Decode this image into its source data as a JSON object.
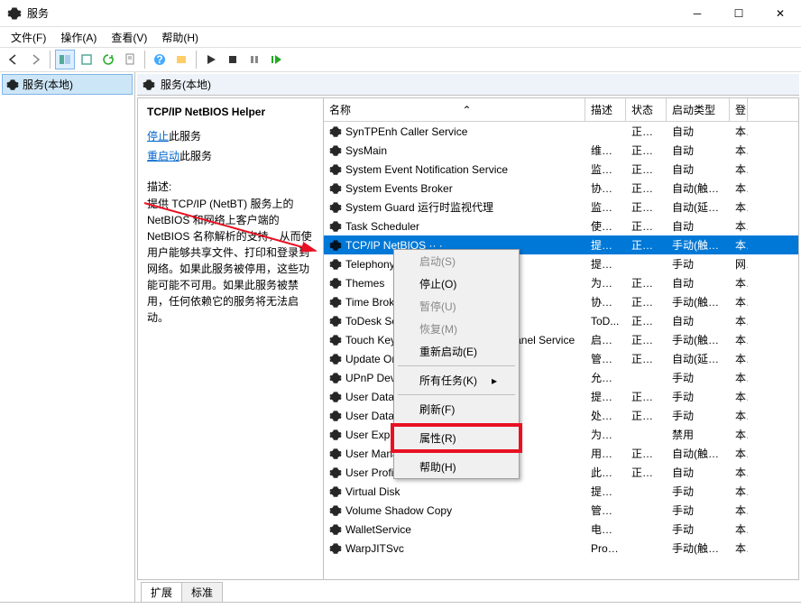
{
  "window": {
    "title": "服务"
  },
  "menus": {
    "file": "文件(F)",
    "action": "操作(A)",
    "view": "查看(V)",
    "help": "帮助(H)"
  },
  "left": {
    "node": "服务(本地)"
  },
  "rheader": {
    "title": "服务(本地)"
  },
  "detail": {
    "name": "TCP/IP NetBIOS Helper",
    "stop": "停止",
    "restart": "重启动",
    "suffix": "此服务",
    "desc_label": "描述:",
    "desc": "提供 TCP/IP (NetBT) 服务上的 NetBIOS 和网络上客户端的 NetBIOS 名称解析的支持，从而使用户能够共享文件、打印和登录到网络。如果此服务被停用，这些功能可能不可用。如果此服务被禁用，任何依赖它的服务将无法启动。"
  },
  "columns": {
    "name": "名称",
    "desc": "描述",
    "status": "状态",
    "start": "启动类型",
    "logon": "登"
  },
  "sort_arrow": "⌃",
  "services": [
    {
      "n": "SynTPEnh Caller Service",
      "d": "",
      "s": "正在...",
      "t": "自动",
      "l": "本"
    },
    {
      "n": "SysMain",
      "d": "维护...",
      "s": "正在...",
      "t": "自动",
      "l": "本"
    },
    {
      "n": "System Event Notification Service",
      "d": "监视...",
      "s": "正在...",
      "t": "自动",
      "l": "本"
    },
    {
      "n": "System Events Broker",
      "d": "协调...",
      "s": "正在...",
      "t": "自动(触发...",
      "l": "本"
    },
    {
      "n": "System Guard 运行时监视代理",
      "d": "监视...",
      "s": "正在...",
      "t": "自动(延迟...",
      "l": "本"
    },
    {
      "n": "Task Scheduler",
      "d": "使用...",
      "s": "正在...",
      "t": "自动",
      "l": "本"
    },
    {
      "n": "TCP/IP NetBIOS Helper",
      "d": "提供 ...",
      "s": "正在...",
      "t": "手动(触发...",
      "l": "本",
      "sel": true,
      "trunc": "TCP/IP NetBIOS ·· ·"
    },
    {
      "n": "Telephony",
      "d": "提供...",
      "s": "",
      "t": "手动",
      "l": "网"
    },
    {
      "n": "Themes",
      "d": "为用...",
      "s": "正在...",
      "t": "自动",
      "l": "本"
    },
    {
      "n": "Time Broker",
      "d": "协调...",
      "s": "正在...",
      "t": "手动(触发...",
      "l": "本"
    },
    {
      "n": "ToDesk Service",
      "d": "ToD...",
      "s": "正在...",
      "t": "自动",
      "l": "本"
    },
    {
      "n": "Touch Keyboard and Handwriting Panel Service",
      "d": "启用...",
      "s": "正在...",
      "t": "手动(触发...",
      "l": "本"
    },
    {
      "n": "Update Orchestrator",
      "d": "管理...",
      "s": "正在...",
      "t": "自动(延迟...",
      "l": "本"
    },
    {
      "n": "UPnP Device Host",
      "d": "允许...",
      "s": "",
      "t": "手动",
      "l": "本"
    },
    {
      "n": "User Data Access",
      "d": "提供...",
      "s": "正在...",
      "t": "手动",
      "l": "本"
    },
    {
      "n": "User Data Storage",
      "d": "处理...",
      "s": "正在...",
      "t": "手动",
      "l": "本"
    },
    {
      "n": "User Experience",
      "d": "为应...",
      "s": "",
      "t": "禁用",
      "l": "本"
    },
    {
      "n": "User Manager",
      "d": "用户...",
      "s": "正在...",
      "t": "自动(触发...",
      "l": "本"
    },
    {
      "n": "User Profile Service",
      "d": "此服...",
      "s": "正在...",
      "t": "自动",
      "l": "本"
    },
    {
      "n": "Virtual Disk",
      "d": "提供...",
      "s": "",
      "t": "手动",
      "l": "本"
    },
    {
      "n": "Volume Shadow Copy",
      "d": "管理...",
      "s": "",
      "t": "手动",
      "l": "本"
    },
    {
      "n": "WalletService",
      "d": "电子...",
      "s": "",
      "t": "手动",
      "l": "本"
    },
    {
      "n": "WarpJITSvc",
      "d": "Prov...",
      "s": "",
      "t": "手动(触发...",
      "l": "本"
    }
  ],
  "tabs": {
    "ext": "扩展",
    "std": "标准"
  },
  "ctx": {
    "start": "启动(S)",
    "stop": "停止(O)",
    "pause": "暂停(U)",
    "resume": "恢复(M)",
    "restart": "重新启动(E)",
    "alltasks": "所有任务(K)",
    "refresh": "刷新(F)",
    "properties": "属性(R)",
    "help": "帮助(H)",
    "arrow": "▸"
  }
}
